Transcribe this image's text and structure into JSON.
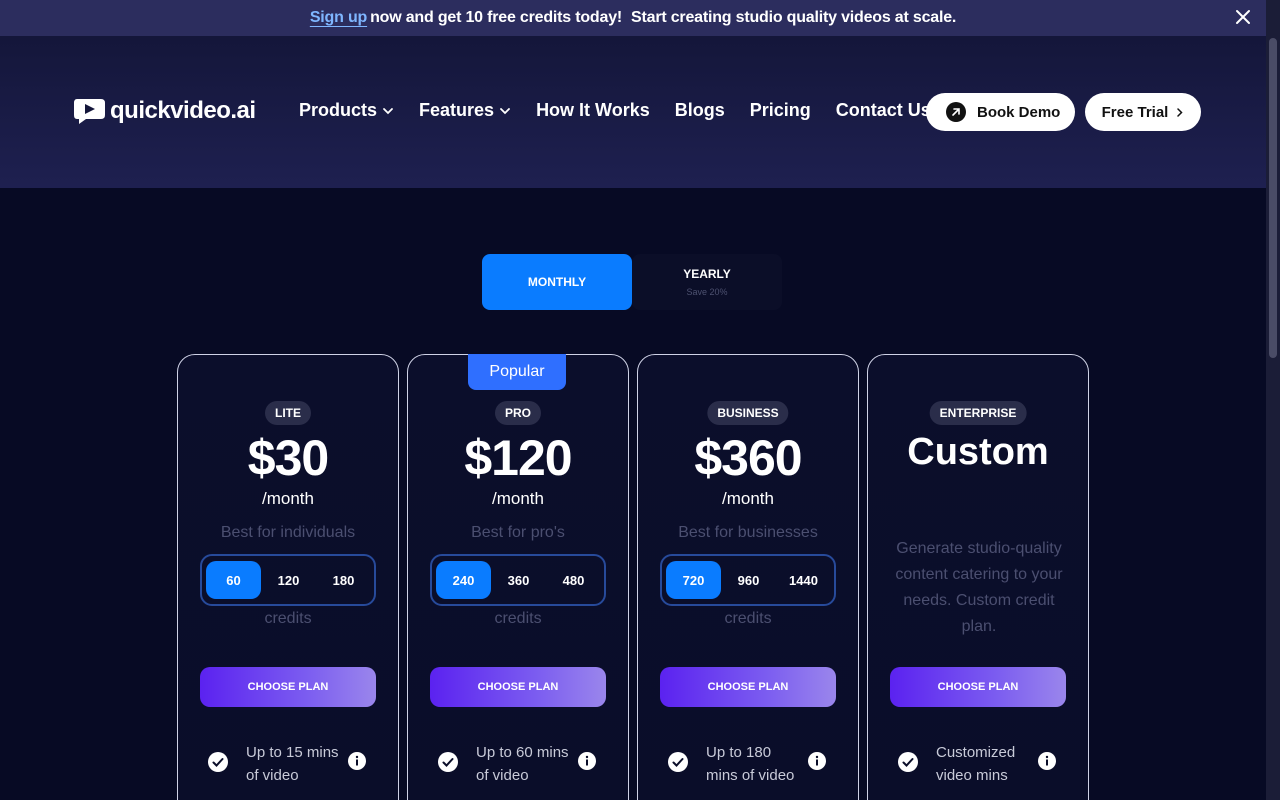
{
  "announcement": {
    "signup_link": "Sign up",
    "message": "now and get 10 free credits today!",
    "message2": "Start creating studio quality videos at scale."
  },
  "header": {
    "logo_text": "quickvideo.ai",
    "nav": [
      "Products",
      "Features",
      "How It Works",
      "Blogs",
      "Pricing",
      "Contact Us"
    ],
    "book_demo": "Book Demo",
    "free_trial": "Free Trial"
  },
  "billing": {
    "monthly": "MONTHLY",
    "yearly": "YEARLY",
    "yearly_note": "Save 20%",
    "selected": "MONTHLY"
  },
  "popular_badge": "Popular",
  "plans": [
    {
      "tier": "LITE",
      "price": "$30",
      "period": "/month",
      "tagline": "Best for individuals",
      "credit_options": [
        "60",
        "120",
        "180"
      ],
      "credit_selected": "60",
      "credits_label": "credits",
      "cta": "CHOOSE PLAN",
      "feature": "Up to 15 mins of video"
    },
    {
      "tier": "PRO",
      "price": "$120",
      "period": "/month",
      "tagline": "Best for pro's",
      "credit_options": [
        "240",
        "360",
        "480"
      ],
      "credit_selected": "240",
      "credits_label": "credits",
      "cta": "CHOOSE PLAN",
      "feature": "Up to 60 mins of video"
    },
    {
      "tier": "BUSINESS",
      "price": "$360",
      "period": "/month",
      "tagline": "Best for businesses",
      "credit_options": [
        "720",
        "960",
        "1440"
      ],
      "credit_selected": "720",
      "credits_label": "credits",
      "cta": "CHOOSE PLAN",
      "feature": "Up to 180 mins of video"
    },
    {
      "tier": "ENTERPRISE",
      "price": "Custom",
      "description": "Generate studio-quality content catering to your needs. Custom credit plan.",
      "cta": "CHOOSE PLAN",
      "feature": "Customized video mins"
    }
  ],
  "colors": {
    "background": "#070a24",
    "accent": "#0a7cff",
    "cta_gradient_start": "#5b22f0",
    "cta_gradient_end": "#9a86ec",
    "popular": "#2f6fff"
  }
}
